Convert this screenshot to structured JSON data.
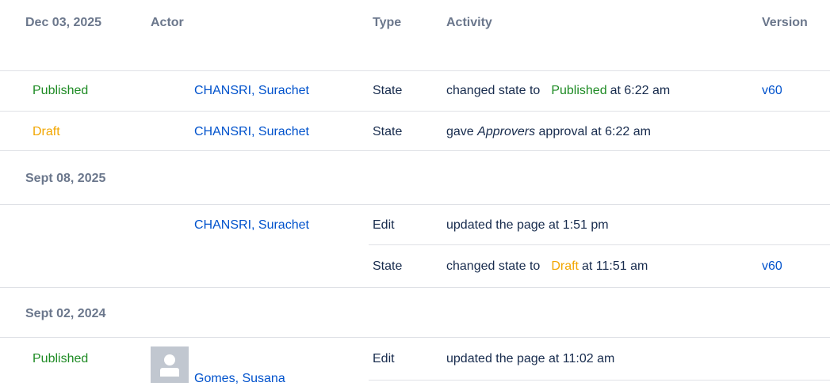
{
  "header": {
    "date_label": "Dec 03, 2025",
    "actor": "Actor",
    "type": "Type",
    "activity": "Activity",
    "version": "Version"
  },
  "group1": {
    "rows": [
      {
        "status": "Published",
        "actor": "CHANSRI, Surachet",
        "type": "State",
        "activity_pre": "changed state to",
        "activity_tag": "Published",
        "activity_post": "at 6:22 am",
        "version": "v60"
      },
      {
        "status": "Draft",
        "actor": "CHANSRI, Surachet",
        "type": "State",
        "activity_pre": "gave",
        "activity_em": "Approvers",
        "activity_post": "approval at 6:22 am"
      }
    ]
  },
  "group2": {
    "date": "Sept 08, 2025",
    "rows": [
      {
        "actor": "CHANSRI, Surachet",
        "type": "Edit",
        "activity": "updated the page at 1:51 pm"
      },
      {
        "type": "State",
        "activity_pre": "changed state to",
        "activity_tag": "Draft",
        "activity_post": "at 11:51 am",
        "version": "v60"
      }
    ]
  },
  "group3": {
    "date": "Sept 02, 2024",
    "rows": [
      {
        "status": "Published",
        "actor": "Gomes, Susana",
        "avatar_icon": "default-user-avatar-icon",
        "type": "Edit",
        "activity": "updated the page at 11:02 am"
      }
    ]
  },
  "colors": {
    "published": "#1e8b24",
    "draft": "#f2a600",
    "link": "#0052cc",
    "header_text": "#6b778c",
    "divider": "#dfe1e6"
  }
}
